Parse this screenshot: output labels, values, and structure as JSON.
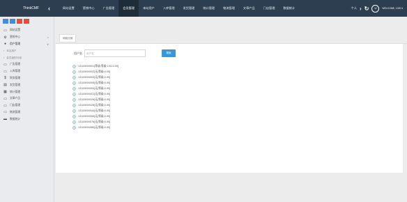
{
  "brand": {
    "name": "ThinkCMF",
    "collapse_icon": "chevron-left-icon"
  },
  "nav": [
    {
      "label": "网站设置"
    },
    {
      "label": "营销中心"
    },
    {
      "label": "广告管理"
    },
    {
      "label": "会员管理",
      "active": true
    },
    {
      "label": "本站用户"
    },
    {
      "label": "入库管理"
    },
    {
      "label": "发货管理"
    },
    {
      "label": "统计管理"
    },
    {
      "label": "物流管理"
    },
    {
      "label": "文章产品"
    },
    {
      "label": "门店管理"
    },
    {
      "label": "数据统计"
    }
  ],
  "topright": {
    "more": "个人",
    "welcome": "WELCOME, 1020 ▾"
  },
  "shortcuts": [
    "#3a8ee6",
    "#3a8ee6",
    "#e74c3c",
    "#e74c3c"
  ],
  "sidebar": [
    {
      "label": "网站设置",
      "icon": "monitor-icon"
    },
    {
      "label": "营销中心",
      "icon": "gear-icon",
      "chevron": ">"
    },
    {
      "label": "用户管理",
      "icon": "user-icon",
      "chevron": "∨",
      "open": true
    },
    {
      "label": "本站用户",
      "sub": true
    },
    {
      "label": "会员级别分组",
      "sub": true
    },
    {
      "label": "广告管理",
      "icon": "monitor-icon"
    },
    {
      "label": "入库管理",
      "icon": "monitor-icon"
    },
    {
      "label": "财务管理",
      "icon": "dollar-icon"
    },
    {
      "label": "发货管理",
      "icon": "list-icon"
    },
    {
      "label": "统计管理",
      "icon": "document-icon"
    },
    {
      "label": "文章产品",
      "icon": "monitor-icon"
    },
    {
      "label": "门店管理",
      "icon": "monitor-icon"
    },
    {
      "label": "物流管理",
      "icon": "monitor-icon"
    },
    {
      "label": "数据统计",
      "icon": "chart-icon"
    }
  ],
  "tab": {
    "label": "网络分销"
  },
  "search": {
    "label": "用户名",
    "placeholder": "用户名",
    "button": "搜索"
  },
  "tree": [
    "13100000001[等级:等级:10113.00]",
    "13100000002[无|等级:0.00]",
    "13100000003[无|等级:0.00]",
    "13100000005[无|等级:0.00]",
    "13100000004[无|等级:0.00]",
    "13100000001[无|等级:0.00]",
    "13100000026[无|等级:0.00]",
    "13100000028[无|等级:0.00]",
    "13100000044[无|等级:0.00]",
    "13100000055[无|等级:0.00]",
    "13100000076[无|等级:0.00]",
    "13100000080[无|等级:0.00]"
  ]
}
